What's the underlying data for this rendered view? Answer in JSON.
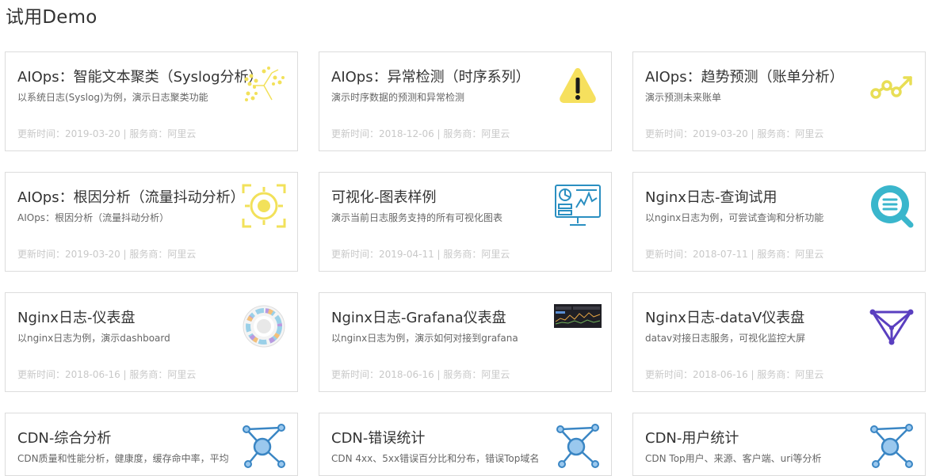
{
  "page": {
    "title": "试用Demo"
  },
  "cards": [
    {
      "title": "AIOps：智能文本聚类（Syslog分析）",
      "desc": "以系统日志(Syslog)为例，演示日志聚类功能",
      "meta": "更新时间：2019-03-20 | 服务商：阿里云",
      "icon": "text-cluster-icon"
    },
    {
      "title": "AIOps：异常检测（时序系列）",
      "desc": "演示时序数据的预测和异常检测",
      "meta": "更新时间：2018-12-06 | 服务商：阿里云",
      "icon": "warning-icon"
    },
    {
      "title": "AIOps：趋势预测（账单分析）",
      "desc": "演示预测未来账单",
      "meta": "更新时间：2019-03-20 | 服务商：阿里云",
      "icon": "trend-icon"
    },
    {
      "title": "AIOps：根因分析（流量抖动分析）",
      "desc": "AIOps：根因分析（流量抖动分析）",
      "meta": "更新时间：2019-03-20 | 服务商：阿里云",
      "icon": "target-icon"
    },
    {
      "title": "可视化-图表样例",
      "desc": "演示当前日志服务支持的所有可视化图表",
      "meta": "更新时间：2019-04-11 | 服务商：阿里云",
      "icon": "dashboard-monitor-icon"
    },
    {
      "title": "Nginx日志-查询试用",
      "desc": "以nginx日志为例，可尝试查询和分析功能",
      "meta": "更新时间：2018-07-11 | 服务商：阿里云",
      "icon": "search-icon"
    },
    {
      "title": "Nginx日志-仪表盘",
      "desc": "以nginx日志为例，演示dashboard",
      "meta": "更新时间：2018-06-16 | 服务商：阿里云",
      "icon": "sunburst-chart-icon"
    },
    {
      "title": "Nginx日志-Grafana仪表盘",
      "desc": "以nginx日志为例，演示如何对接到grafana",
      "meta": "更新时间：2018-06-16 | 服务商：阿里云",
      "icon": "grafana-thumbnail-icon"
    },
    {
      "title": "Nginx日志-dataV仪表盘",
      "desc": "datav对接日志服务，可视化监控大屏",
      "meta": "更新时间：2018-06-16 | 服务商：阿里云",
      "icon": "datav-logo-icon"
    },
    {
      "title": "CDN-综合分析",
      "desc": "CDN质量和性能分析，健康度，缓存命中率，平均",
      "meta": "",
      "icon": "network-graph-icon"
    },
    {
      "title": "CDN-错误统计",
      "desc": "CDN 4xx、5xx错误百分比和分布，错误Top域名",
      "meta": "",
      "icon": "network-graph-icon"
    },
    {
      "title": "CDN-用户统计",
      "desc": "CDN Top用户、来源、客户端、uri等分析",
      "meta": "",
      "icon": "network-graph-icon"
    }
  ]
}
